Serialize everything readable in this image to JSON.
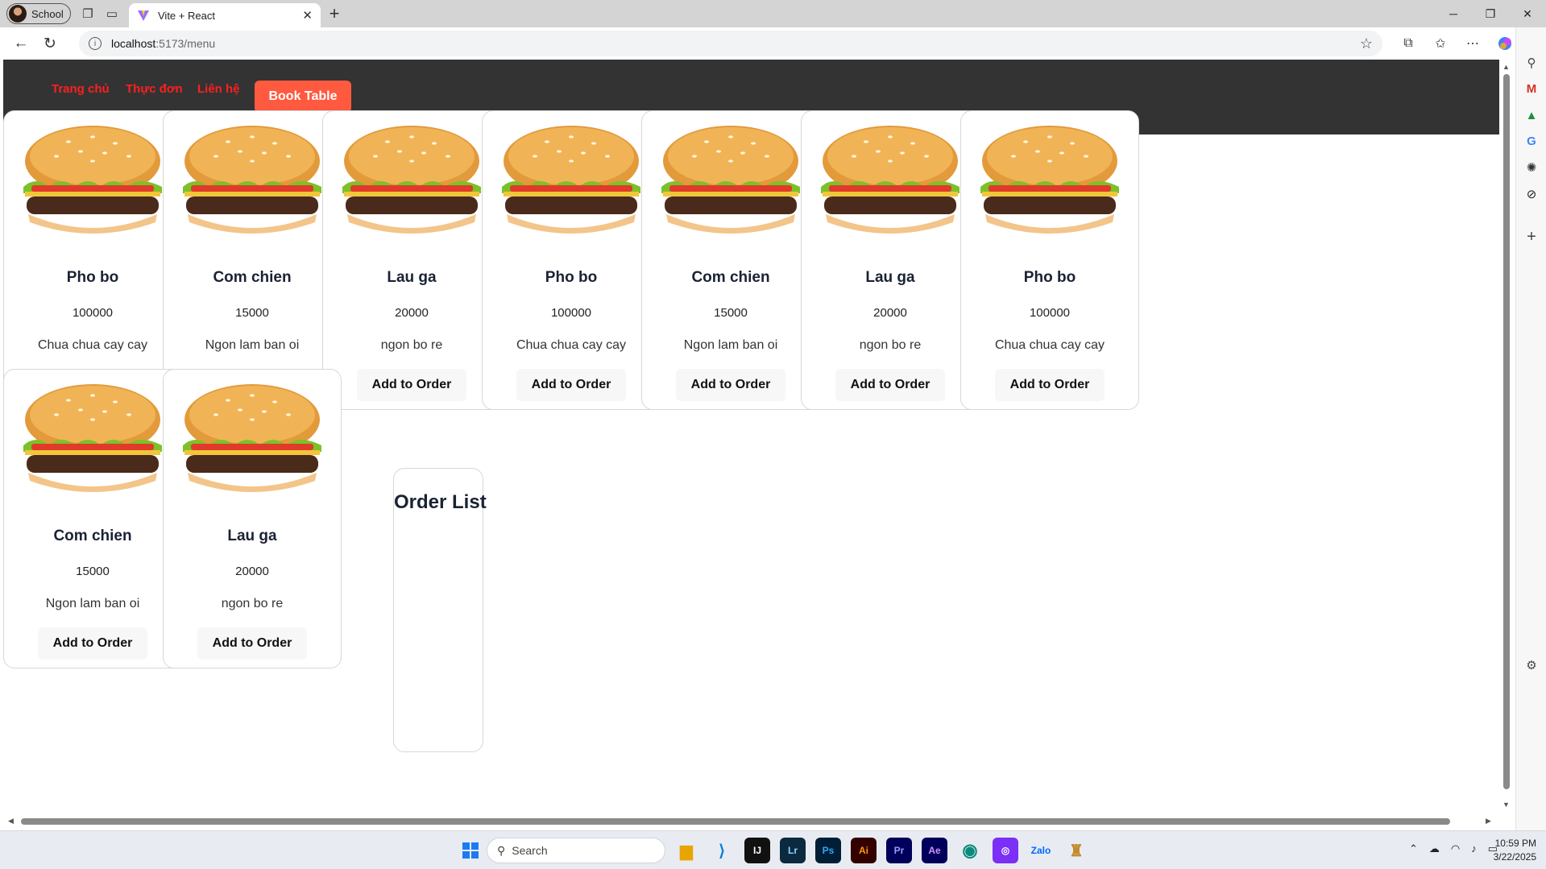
{
  "browser": {
    "profile_label": "School",
    "tab_title": "Vite + React",
    "url_host": "localhost",
    "url_path": ":5173/menu"
  },
  "site": {
    "nav": [
      {
        "label": "Trang chủ"
      },
      {
        "label": "Thực đơn"
      },
      {
        "label": "Liên hệ"
      }
    ],
    "book_button": "Book Table",
    "add_button": "Add to Order",
    "order_list_title": "Order List"
  },
  "menu_items": [
    {
      "name": "Pho bo",
      "price": "100000",
      "desc": "Chua chua cay cay"
    },
    {
      "name": "Com chien",
      "price": "15000",
      "desc": "Ngon lam ban oi"
    },
    {
      "name": "Lau ga",
      "price": "20000",
      "desc": "ngon bo re"
    },
    {
      "name": "Pho bo",
      "price": "100000",
      "desc": "Chua chua cay cay"
    },
    {
      "name": "Com chien",
      "price": "15000",
      "desc": "Ngon lam ban oi"
    },
    {
      "name": "Lau ga",
      "price": "20000",
      "desc": "ngon bo re"
    },
    {
      "name": "Pho bo",
      "price": "100000",
      "desc": "Chua chua cay cay"
    },
    {
      "name": "Com chien",
      "price": "15000",
      "desc": "Ngon lam ban oi"
    },
    {
      "name": "Lau ga",
      "price": "20000",
      "desc": "ngon bo re"
    }
  ],
  "taskbar": {
    "search_label": "Search",
    "time": "10:59 PM",
    "date": "3/22/2025"
  },
  "colors": {
    "header_bg": "#333333",
    "nav_link": "#ff1f1f",
    "book_button": "#ff5a40"
  }
}
